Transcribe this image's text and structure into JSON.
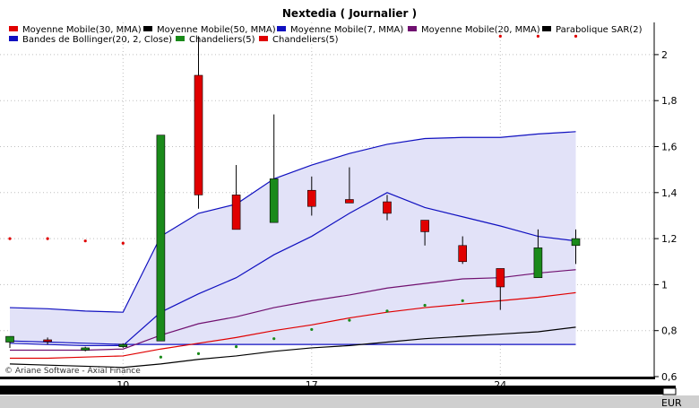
{
  "chart_data": {
    "type": "candlestick",
    "title": "Nextedia  ( Journalier )",
    "credit": "© Ariane Software - Axial Finance",
    "unit": "EUR",
    "legend": [
      {
        "label": "Moyenne Mobile(30, MMA)",
        "color": "#e00000"
      },
      {
        "label": "Moyenne Mobile(50, MMA)",
        "color": "#000000"
      },
      {
        "label": "Moyenne Mobile(7, MMA)",
        "color": "#1010c0"
      },
      {
        "label": "Moyenne Mobile(20, MMA)",
        "color": "#701070"
      },
      {
        "label": "Parabolique SAR(2)",
        "color": "#000000"
      },
      {
        "label": "Bandes de Bollinger(20, 2, Close)",
        "color": "#1010c0"
      },
      {
        "label": "Chandeliers(5)",
        "color": "#1a8a1a"
      },
      {
        "label": "Chandeliers(5)",
        "color": "#e00000"
      }
    ],
    "x_ticks": [
      {
        "label": "10",
        "index": 3
      },
      {
        "label": "17",
        "index": 8
      },
      {
        "label": "24",
        "index": 13
      }
    ],
    "y_ticks": [
      "0,6",
      "0,8",
      "1",
      "1,2",
      "1,4",
      "1,6",
      "1,8",
      "2"
    ],
    "y_tick_values": [
      0.6,
      0.8,
      1.0,
      1.2,
      1.4,
      1.6,
      1.8,
      2.0
    ],
    "ylim": [
      0.6,
      2.14
    ],
    "candles": [
      {
        "open": 0.75,
        "high": 0.775,
        "low": 0.725,
        "close": 0.775
      },
      {
        "open": 0.76,
        "high": 0.77,
        "low": 0.74,
        "close": 0.755
      },
      {
        "open": 0.715,
        "high": 0.73,
        "low": 0.71,
        "close": 0.725
      },
      {
        "open": 0.73,
        "high": 0.745,
        "low": 0.725,
        "close": 0.74
      },
      {
        "open": 0.755,
        "high": 1.65,
        "low": 0.755,
        "close": 1.65
      },
      {
        "open": 1.91,
        "high": 2.08,
        "low": 1.33,
        "close": 1.39
      },
      {
        "open": 1.39,
        "high": 1.52,
        "low": 1.24,
        "close": 1.24
      },
      {
        "open": 1.27,
        "high": 1.74,
        "low": 1.27,
        "close": 1.46
      },
      {
        "open": 1.41,
        "high": 1.47,
        "low": 1.3,
        "close": 1.34
      },
      {
        "open": 1.37,
        "high": 1.51,
        "low": 1.355,
        "close": 1.355
      },
      {
        "open": 1.36,
        "high": 1.39,
        "low": 1.28,
        "close": 1.31
      },
      {
        "open": 1.28,
        "high": 1.28,
        "low": 1.17,
        "close": 1.23
      },
      {
        "open": 1.17,
        "high": 1.21,
        "low": 1.09,
        "close": 1.1
      },
      {
        "open": 1.07,
        "high": 1.07,
        "low": 0.89,
        "close": 0.99
      },
      {
        "open": 1.03,
        "high": 1.24,
        "low": 1.03,
        "close": 1.16
      },
      {
        "open": 1.17,
        "high": 1.24,
        "low": 1.09,
        "close": 1.2
      }
    ],
    "series": [
      {
        "name": "Bandes de Bollinger(20, 2, Close)",
        "color": "#1010c0",
        "values": [
          0.9,
          0.895,
          0.885,
          0.88,
          1.21,
          1.31,
          1.35,
          1.46,
          1.52,
          1.57,
          1.61,
          1.635,
          1.64,
          1.64,
          1.655,
          1.665
        ]
      },
      {
        "name": "Bandes de Bollinger(20, 2, Close)",
        "color": "#1010c0",
        "values": [
          0.755,
          0.75,
          0.745,
          0.74,
          0.74,
          0.74,
          0.74,
          0.74,
          0.74,
          0.74,
          0.74,
          0.74,
          0.74,
          0.74,
          0.74,
          0.74
        ]
      },
      {
        "name": "Moyenne Mobile(7, MMA)",
        "color": "#1010c0",
        "values": [
          0.745,
          0.74,
          0.735,
          0.735,
          0.88,
          0.96,
          1.03,
          1.13,
          1.21,
          1.31,
          1.4,
          1.335,
          1.295,
          1.255,
          1.21,
          1.19
        ]
      },
      {
        "name": "Moyenne Mobile(20, MMA)",
        "color": "#701070",
        "values": [
          0.715,
          0.715,
          0.715,
          0.72,
          0.78,
          0.83,
          0.86,
          0.9,
          0.93,
          0.955,
          0.985,
          1.005,
          1.025,
          1.03,
          1.05,
          1.065
        ]
      },
      {
        "name": "Moyenne Mobile(30, MMA)",
        "color": "#e00000",
        "values": [
          0.68,
          0.68,
          0.685,
          0.69,
          0.72,
          0.745,
          0.77,
          0.8,
          0.825,
          0.855,
          0.88,
          0.9,
          0.915,
          0.93,
          0.945,
          0.965
        ]
      },
      {
        "name": "Moyenne Mobile(50, MMA)",
        "color": "#000000",
        "values": [
          0.655,
          0.65,
          0.645,
          0.64,
          0.655,
          0.675,
          0.69,
          0.71,
          0.725,
          0.735,
          0.75,
          0.765,
          0.775,
          0.785,
          0.795,
          0.815
        ]
      }
    ],
    "sar": [
      {
        "index": 0,
        "value": 1.2,
        "color": "#e00000"
      },
      {
        "index": 1,
        "value": 1.2,
        "color": "#e00000"
      },
      {
        "index": 2,
        "value": 1.19,
        "color": "#e00000"
      },
      {
        "index": 3,
        "value": 1.18,
        "color": "#e00000"
      },
      {
        "index": 4,
        "value": 0.685,
        "color": "#1a8a1a"
      },
      {
        "index": 5,
        "value": 0.7,
        "color": "#1a8a1a"
      },
      {
        "index": 6,
        "value": 0.73,
        "color": "#1a8a1a"
      },
      {
        "index": 7,
        "value": 0.765,
        "color": "#1a8a1a"
      },
      {
        "index": 8,
        "value": 0.805,
        "color": "#1a8a1a"
      },
      {
        "index": 9,
        "value": 0.845,
        "color": "#1a8a1a"
      },
      {
        "index": 10,
        "value": 0.885,
        "color": "#1a8a1a"
      },
      {
        "index": 11,
        "value": 0.91,
        "color": "#1a8a1a"
      },
      {
        "index": 12,
        "value": 0.93,
        "color": "#1a8a1a"
      },
      {
        "index": 13,
        "value": 2.08,
        "color": "#e00000"
      },
      {
        "index": 14,
        "value": 2.08,
        "color": "#e00000"
      },
      {
        "index": 15,
        "value": 2.08,
        "color": "#e00000"
      }
    ],
    "colors": {
      "band_fill": "#e2e2f8",
      "up": "#1a8a1a",
      "down": "#e00000",
      "grid": "#bfbfbf",
      "scroll_track": "#cfcfcf",
      "scroll_thumb": "#000000"
    }
  }
}
